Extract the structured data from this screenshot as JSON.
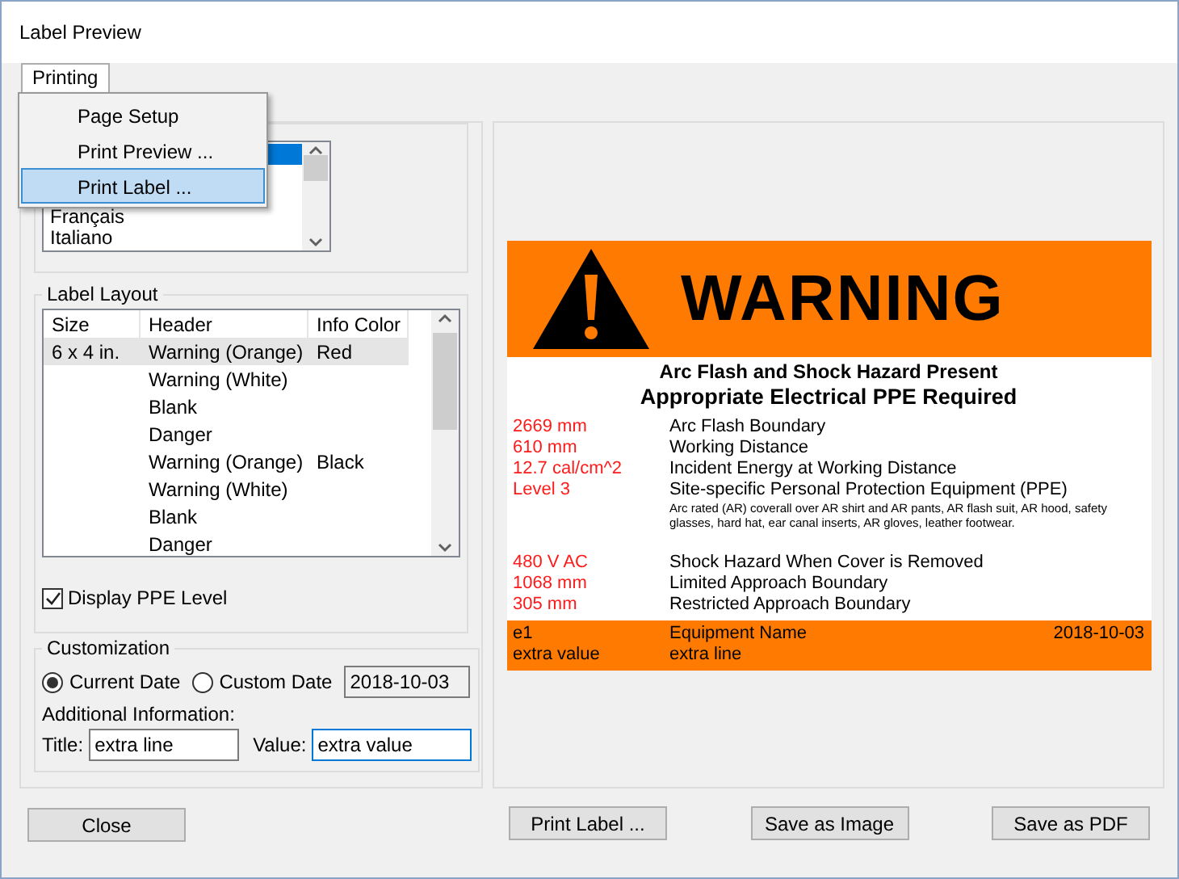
{
  "window": {
    "title": "Label Preview"
  },
  "menu_tab": {
    "label": "Printing",
    "expanded": true
  },
  "menu_items": [
    {
      "label": "Page Setup",
      "selected": false
    },
    {
      "label": "Print Preview ...",
      "selected": false
    },
    {
      "label": "Print Label ...",
      "selected": true
    }
  ],
  "languages": [
    {
      "selected": true
    },
    {
      "selected": false
    },
    {
      "selected": false
    },
    {
      "label": "Français",
      "selected": false
    },
    {
      "label": "Italiano",
      "selected": false
    }
  ],
  "label_layout": {
    "title": "Label Layout",
    "columns": [
      "Size",
      "Header",
      "Info Color"
    ],
    "rows": [
      {
        "cells": [
          "6 x 4 in.",
          "Warning (Orange)",
          "Red"
        ],
        "selected": true
      },
      {
        "cells": [
          "",
          "Warning (White)",
          ""
        ],
        "selected": false
      },
      {
        "cells": [
          "",
          "Blank",
          ""
        ],
        "selected": false
      },
      {
        "cells": [
          "",
          "Danger",
          ""
        ],
        "selected": false
      },
      {
        "cells": [
          "",
          "Warning (Orange)",
          "Black"
        ],
        "selected": false
      },
      {
        "cells": [
          "",
          "Warning (White)",
          ""
        ],
        "selected": false
      },
      {
        "cells": [
          "",
          "Blank",
          ""
        ],
        "selected": false
      },
      {
        "cells": [
          "",
          "Danger",
          ""
        ],
        "selected": false
      }
    ]
  },
  "display_ppe": {
    "label": "Display PPE Level",
    "checked": true
  },
  "customization": {
    "title": "Customization",
    "date_options": [
      {
        "label": "Current Date",
        "selected": true
      },
      {
        "label": "Custom Date",
        "selected": false
      }
    ],
    "custom_date": "2018-10-03",
    "additional_label": "Additional Information:",
    "title_label": "Title:",
    "title_value": "extra line",
    "value_label": "Value:",
    "value_value": "extra value"
  },
  "close_button": "Close",
  "preview": {
    "header": "WARNING",
    "subtitle_1": "Arc Flash and Shock Hazard Present",
    "subtitle_2": "Appropriate Electrical PPE Required",
    "rows": [
      {
        "value": "2669 mm",
        "text": "Arc Flash Boundary"
      },
      {
        "value": "610 mm",
        "text": "Working Distance"
      },
      {
        "value": "12.7 cal/cm^2",
        "text": "Incident Energy at Working Distance"
      },
      {
        "value": "Level 3",
        "text": "Site-specific Personal Protection Equipment (PPE)",
        "note": "Arc rated (AR) coverall over AR shirt and AR pants, AR flash suit, AR hood, safety glasses, hard hat, ear canal inserts, AR gloves, leather footwear."
      }
    ],
    "shock_rows": [
      {
        "value": "480 V AC",
        "text": "Shock Hazard When Cover is Removed"
      },
      {
        "value": "1068 mm",
        "text": "Limited Approach Boundary"
      },
      {
        "value": "305 mm",
        "text": "Restricted Approach Boundary"
      }
    ],
    "footer": {
      "id": "e1",
      "name": "Equipment Name",
      "date": "2018-10-03",
      "value": "extra value",
      "line": "extra line"
    }
  },
  "buttons": [
    "Print Label ...",
    "Save as Image",
    "Save as PDF"
  ]
}
